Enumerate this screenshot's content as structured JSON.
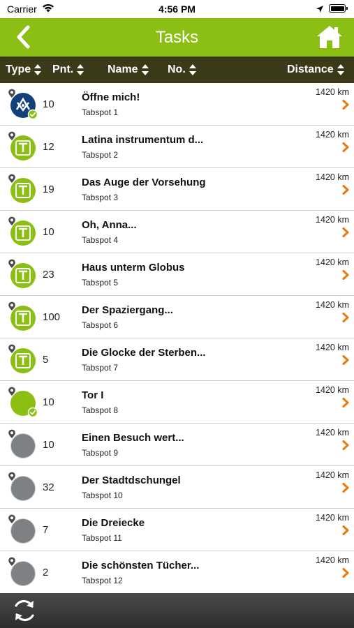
{
  "status_bar": {
    "carrier": "Carrier",
    "time": "4:56 PM"
  },
  "header": {
    "title": "Tasks",
    "back_icon": "chevron-left-icon",
    "home_icon": "home-icon"
  },
  "columns": [
    {
      "label": "Type"
    },
    {
      "label": "Pnt."
    },
    {
      "label": "Name"
    },
    {
      "label": "No."
    },
    {
      "label": "Distance"
    }
  ],
  "colors": {
    "accent_green": "#8cbf13",
    "header_dark": "#3a3a18",
    "chevron_orange": "#e87c14",
    "grey_badge": "#7d8184",
    "blue_badge": "#12407a"
  },
  "tasks": [
    {
      "type": "blue",
      "done": true,
      "points": "10",
      "name": "Öffne mich!",
      "subtitle": "Tabspot 1",
      "distance": "1420 km"
    },
    {
      "type": "text",
      "done": false,
      "points": "12",
      "name": "Latina instrumentum d...",
      "subtitle": "Tabspot 2",
      "distance": "1420 km"
    },
    {
      "type": "text",
      "done": false,
      "points": "19",
      "name": "Das Auge der Vorsehung",
      "subtitle": "Tabspot 3",
      "distance": "1420 km"
    },
    {
      "type": "text",
      "done": false,
      "points": "10",
      "name": "Oh, Anna...",
      "subtitle": "Tabspot 4",
      "distance": "1420 km"
    },
    {
      "type": "text",
      "done": false,
      "points": "23",
      "name": "Haus unterm Globus",
      "subtitle": "Tabspot 5",
      "distance": "1420 km"
    },
    {
      "type": "text",
      "done": false,
      "points": "100",
      "name": "Der Spaziergang...",
      "subtitle": "Tabspot 6",
      "distance": "1420 km"
    },
    {
      "type": "text",
      "done": false,
      "points": "5",
      "name": "Die Glocke der Sterben...",
      "subtitle": "Tabspot 7",
      "distance": "1420 km"
    },
    {
      "type": "green",
      "done": true,
      "points": "10",
      "name": "Tor I",
      "subtitle": "Tabspot 8",
      "distance": "1420 km"
    },
    {
      "type": "grey",
      "done": false,
      "points": "10",
      "name": "Einen Besuch wert...",
      "subtitle": "Tabspot 9",
      "distance": "1420 km"
    },
    {
      "type": "grey",
      "done": false,
      "points": "32",
      "name": "Der Stadtdschungel",
      "subtitle": "Tabspot 10",
      "distance": "1420 km"
    },
    {
      "type": "grey",
      "done": false,
      "points": "7",
      "name": "Die Dreiecke",
      "subtitle": "Tabspot 11",
      "distance": "1420 km"
    },
    {
      "type": "grey",
      "done": false,
      "points": "2",
      "name": "Die schönsten Tücher...",
      "subtitle": "Tabspot 12",
      "distance": "1420 km"
    }
  ],
  "footer": {
    "refresh_icon": "refresh-icon"
  }
}
